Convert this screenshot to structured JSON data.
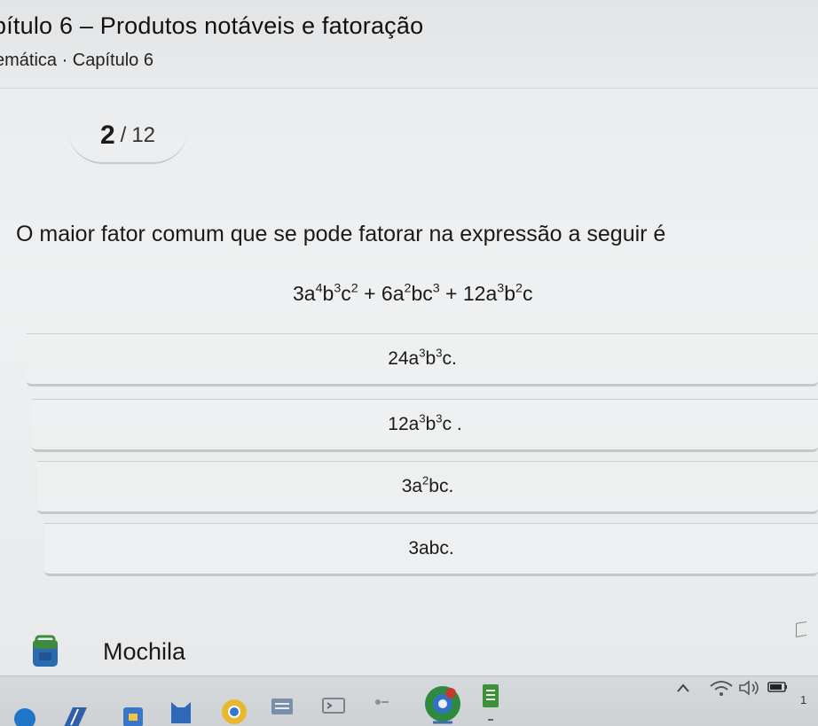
{
  "header": {
    "chapter_title": "pítulo 6 – Produtos notáveis e fatoração",
    "subject": "emática · Capítulo 6"
  },
  "counter": {
    "current": "2",
    "separator": "/",
    "total": "12"
  },
  "question": {
    "text": "O maior fator comum que se pode fatorar na expressão a seguir é"
  },
  "options": [
    {
      "id": "a"
    },
    {
      "id": "b"
    },
    {
      "id": "c"
    },
    {
      "id": "d",
      "label": "3abc."
    }
  ],
  "footer": {
    "section_label": "Mochila"
  },
  "taskbar": {
    "icons": [
      "browser-icon",
      "docs-icon",
      "calendar-icon",
      "files-icon",
      "chrome-icon",
      "gallery-icon",
      "terminal-icon",
      "launcher-icon",
      "color-icon",
      "notes-icon"
    ],
    "tray_icons": [
      "chevron-up-icon",
      "wifi-icon",
      "volume-icon",
      "battery-icon"
    ],
    "time_fragment": "1"
  },
  "colors": {
    "accent_green": "#3c8b3e",
    "mochila_blue": "#2a6bb0"
  }
}
